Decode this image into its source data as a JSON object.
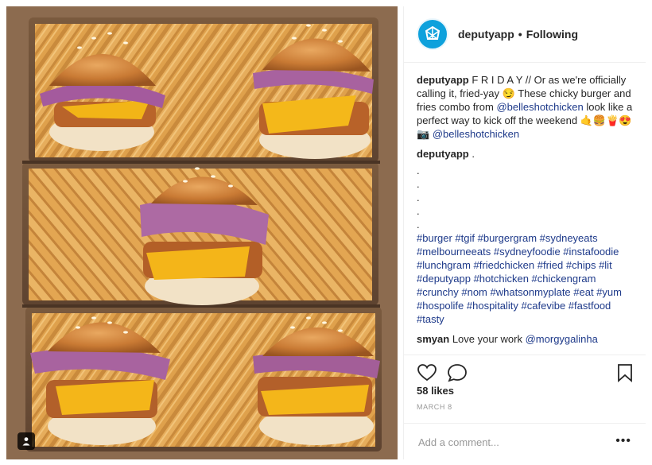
{
  "post": {
    "username": "deputyapp",
    "dot": "•",
    "follow_status": "Following"
  },
  "caption": {
    "username": "deputyapp",
    "text_1": "F R I D A Y // Or as we're officially calling it, fried-yay 😏 These chicky burger and fries combo from",
    "mention_1": "@belleshotchicken",
    "text_2": " look like a perfect way to kick off the weekend 🤙🍔🍟😍",
    "camera": "📷",
    "mention_2": "@belleshotchicken"
  },
  "comment_1": {
    "username": "deputyapp",
    "text": ".",
    "dots": [
      ".",
      ".",
      ".",
      ".",
      "."
    ],
    "hashtags": "#burger #tgif #burgergram #sydneyeats #melbourneeats #sydneyfoodie #instafoodie #lunchgram #friedchicken #fried #chips #lit #deputyapp #hotchicken #chickengram #crunchy #nom #whatsonmyplate #eat #yum #hospolife #hospitality #cafevibe #fastfood #tasty"
  },
  "comment_2": {
    "username": "smyan",
    "text": "Love your work",
    "mention": "@morgygalinha"
  },
  "engagement": {
    "likes": "58 likes",
    "date": "MARCH 8"
  },
  "add_comment": {
    "placeholder": "Add a comment...",
    "more": "•••"
  },
  "colors": {
    "brand": "#0ea1dc",
    "link": "#1e3a8a"
  },
  "icons": [
    "heart-icon",
    "comment-icon",
    "bookmark-icon",
    "user-tag-icon",
    "deputy-logo-icon"
  ]
}
